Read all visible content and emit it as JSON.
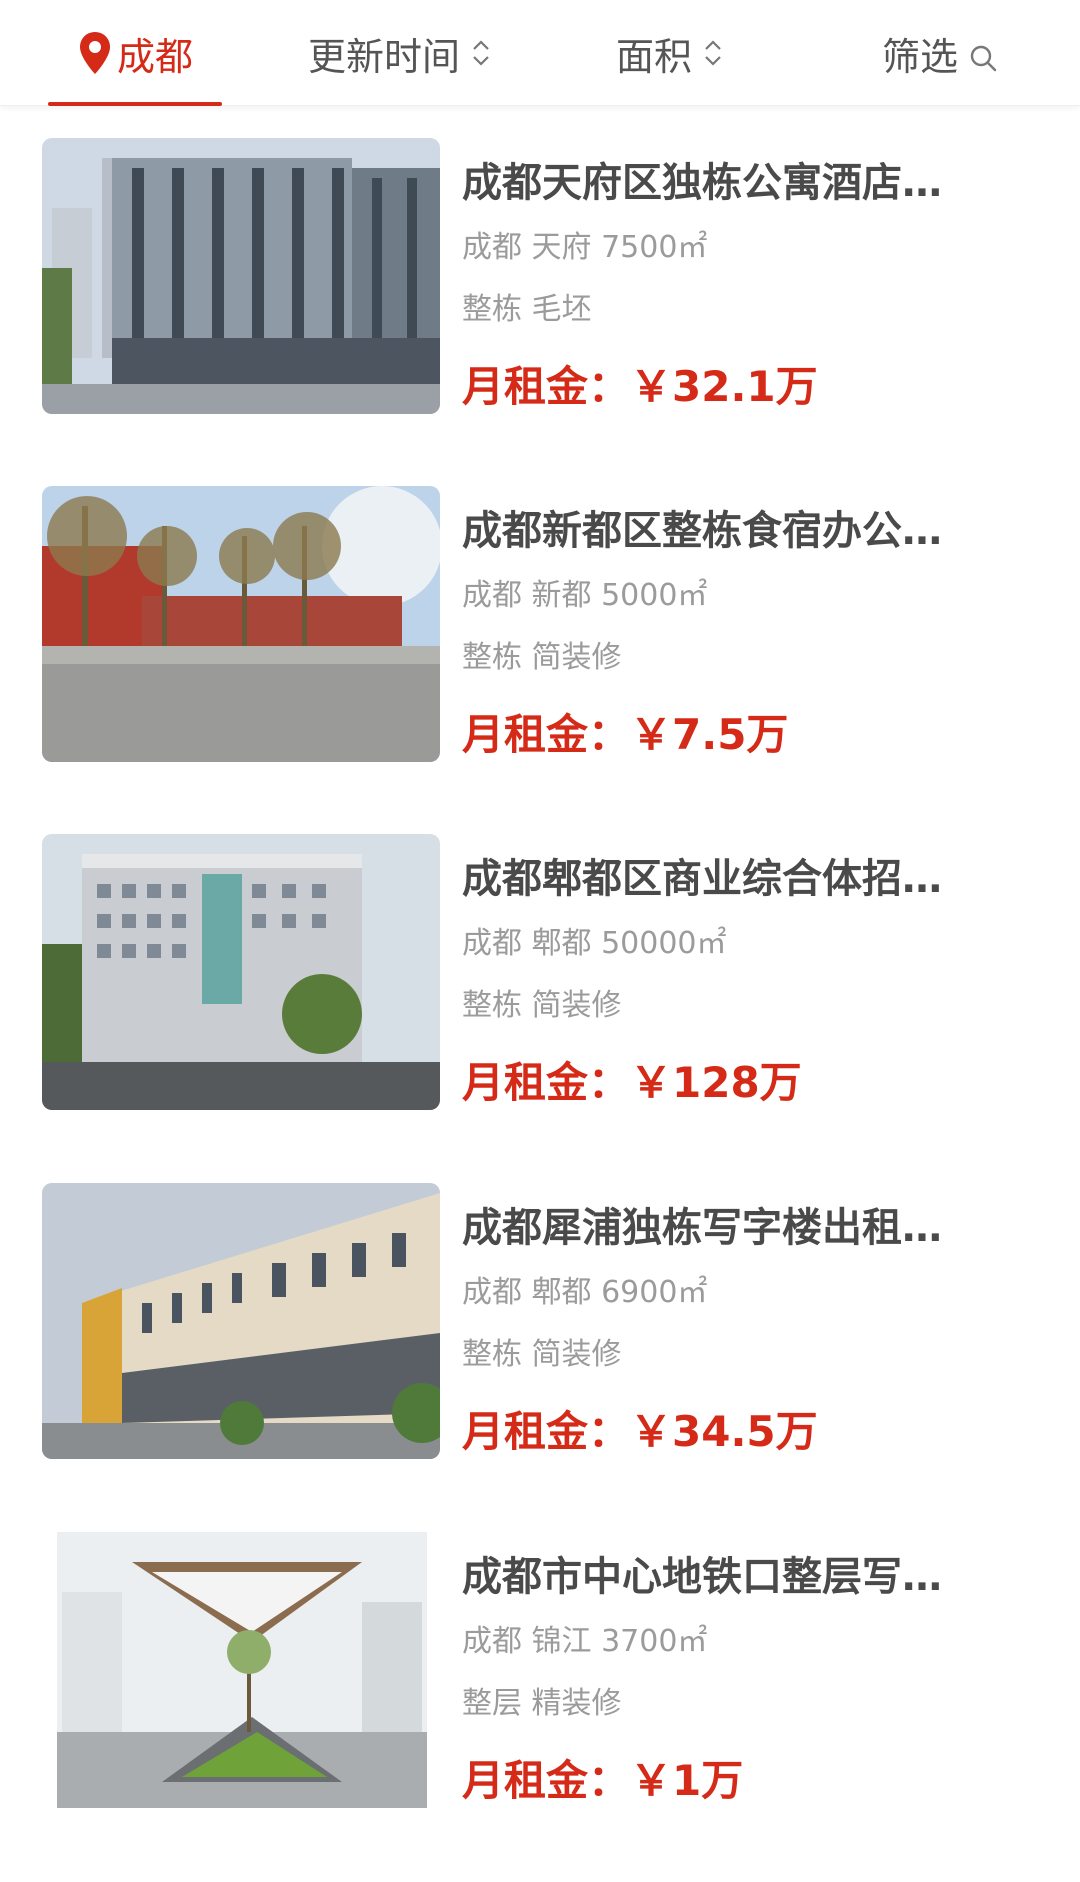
{
  "header": {
    "city": "成都",
    "sort_time": "更新时间",
    "sort_area": "面积",
    "filter": "筛选",
    "accent_color": "#d42a17",
    "icons": [
      "location-pin-icon",
      "sort-updown-icon",
      "search-icon"
    ]
  },
  "listings": [
    {
      "title": "成都天府区独栋公寓酒店…",
      "location": "成都 天府 7500㎡",
      "type": "整栋 毛坯",
      "price_label": "月租金：",
      "price": "￥32.1万"
    },
    {
      "title": "成都新都区整栋食宿办公…",
      "location": "成都 新都 5000㎡",
      "type": "整栋 简装修",
      "price_label": "月租金：",
      "price": "￥7.5万"
    },
    {
      "title": "成都郫都区商业综合体招…",
      "location": "成都 郫都 50000㎡",
      "type": "整栋 简装修",
      "price_label": "月租金：",
      "price": "￥128万"
    },
    {
      "title": "成都犀浦独栋写字楼出租…",
      "location": "成都 郫都 6900㎡",
      "type": "整栋 简装修",
      "price_label": "月租金：",
      "price": "￥34.5万"
    },
    {
      "title": "成都市中心地铁口整层写…",
      "location": "成都 锦江 3700㎡",
      "type": "整层 精装修",
      "price_label": "月租金：",
      "price": "￥1万"
    }
  ]
}
